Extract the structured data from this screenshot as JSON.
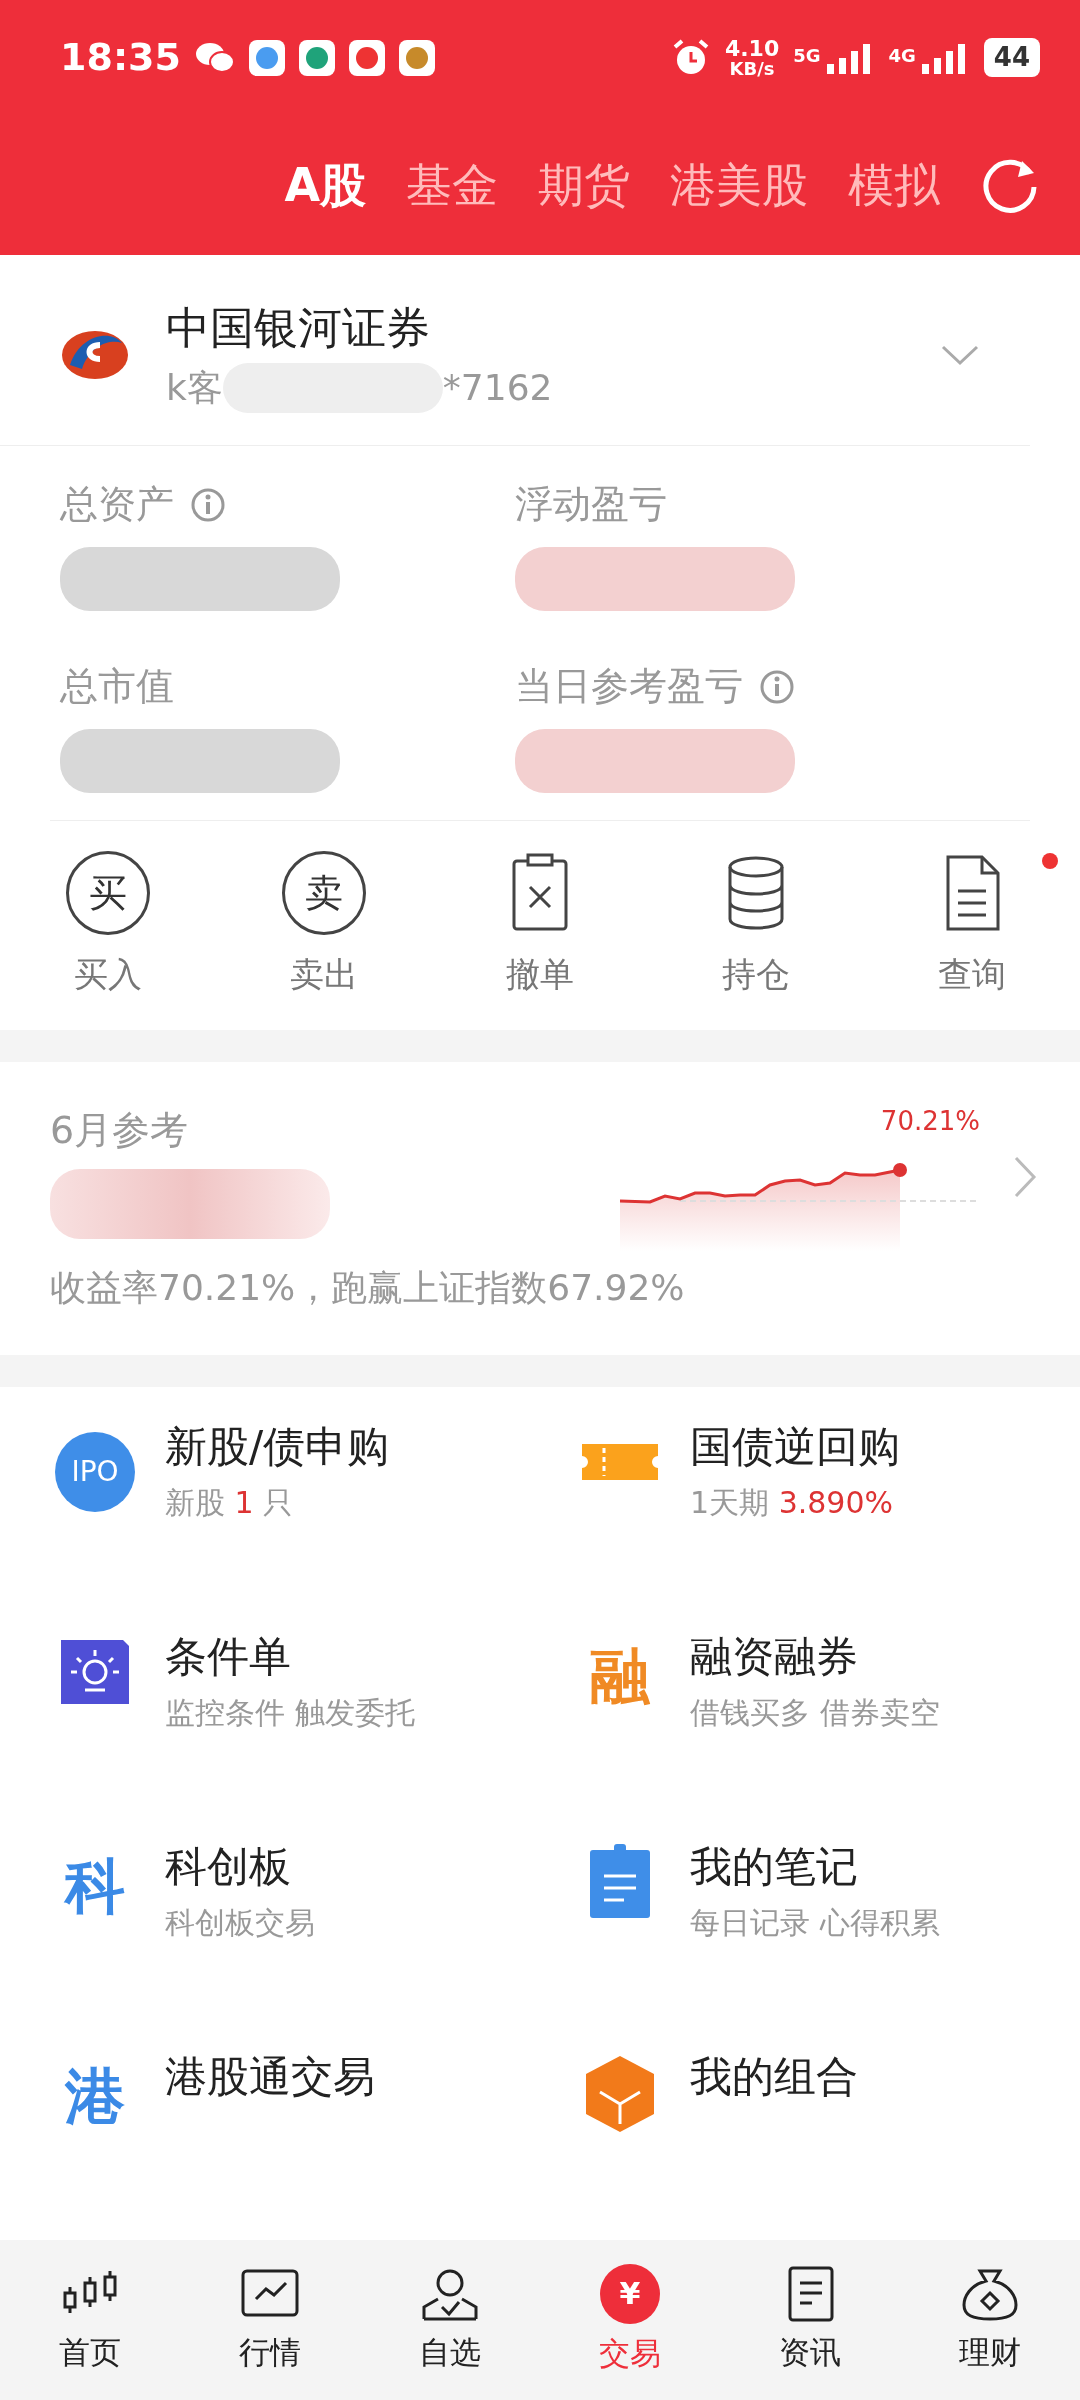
{
  "status_bar": {
    "time": "18:35",
    "net_speed": "4.10",
    "net_unit": "KB/s",
    "signal_1": "5G",
    "signal_2": "4G",
    "battery": "44"
  },
  "tabs": [
    {
      "label": "A股",
      "selected": true
    },
    {
      "label": "基金",
      "selected": false
    },
    {
      "label": "期货",
      "selected": false
    },
    {
      "label": "港美股",
      "selected": false
    },
    {
      "label": "模拟",
      "selected": false
    }
  ],
  "account": {
    "broker": "中国银河证券",
    "id_prefix": "k客",
    "id_suffix": "*7162",
    "id_redacted": true
  },
  "metrics": [
    {
      "label": "总资产",
      "info": true,
      "value_redacted": true,
      "color": "#d8d8d8"
    },
    {
      "label": "浮动盈亏",
      "info": false,
      "value_redacted": true,
      "color": "#f3d0d0"
    },
    {
      "label": "总市值",
      "info": false,
      "value_redacted": true,
      "color": "#d8d8d8"
    },
    {
      "label": "当日参考盈亏",
      "info": true,
      "value_redacted": true,
      "color": "#f3d0d0"
    }
  ],
  "actions": [
    {
      "label": "买入",
      "kind": "circle",
      "icon_text": "买",
      "dot": false
    },
    {
      "label": "卖出",
      "kind": "circle",
      "icon_text": "卖",
      "dot": false
    },
    {
      "label": "撤单",
      "kind": "clipboard",
      "dot": false
    },
    {
      "label": "持仓",
      "kind": "database",
      "dot": false
    },
    {
      "label": "查询",
      "kind": "document",
      "dot": true
    }
  ],
  "monthly": {
    "label": "6月参考",
    "value_redacted": true,
    "peak_label": "70.21%",
    "summary": "收益率70.21%，跑赢上证指数67.92%"
  },
  "services": [
    {
      "title": "新股/债申购",
      "kind": "ipo",
      "icon_text": "IPO",
      "subtitle": [
        {
          "text": "新股 ",
          "highlight": false
        },
        {
          "text": "1",
          "highlight": true
        },
        {
          "text": " 只",
          "highlight": false
        }
      ]
    },
    {
      "title": "国债逆回购",
      "kind": "ticket",
      "subtitle": [
        {
          "text": "1天期 ",
          "highlight": false
        },
        {
          "text": "3.890%",
          "highlight": true
        }
      ]
    },
    {
      "title": "条件单",
      "kind": "bulb",
      "subtitle": [
        {
          "text": "监控条件 触发委托",
          "highlight": false
        }
      ]
    },
    {
      "title": "融资融券",
      "kind": "glyph",
      "icon_text": "融",
      "color": "#f08a24",
      "subtitle": [
        {
          "text": "借钱买多 借券卖空",
          "highlight": false
        }
      ]
    },
    {
      "title": "科创板",
      "kind": "glyph",
      "icon_text": "科",
      "color": "#3b8ae6",
      "subtitle": [
        {
          "text": "科创板交易",
          "highlight": false
        }
      ]
    },
    {
      "title": "我的笔记",
      "kind": "note",
      "subtitle": [
        {
          "text": "每日记录 心得积累",
          "highlight": false
        }
      ]
    },
    {
      "title": "港股通交易",
      "kind": "glyph",
      "icon_text": "港",
      "color": "#3b8ae6"
    },
    {
      "title": "我的组合",
      "kind": "cube"
    }
  ],
  "nav": [
    {
      "label": "首页",
      "kind": "candles",
      "selected": false
    },
    {
      "label": "行情",
      "kind": "chart",
      "selected": false
    },
    {
      "label": "自选",
      "kind": "person",
      "selected": false
    },
    {
      "label": "交易",
      "kind": "yuan",
      "icon_text": "¥",
      "selected": true
    },
    {
      "label": "资讯",
      "kind": "news",
      "selected": false
    },
    {
      "label": "理财",
      "kind": "bag",
      "selected": false
    }
  ]
}
